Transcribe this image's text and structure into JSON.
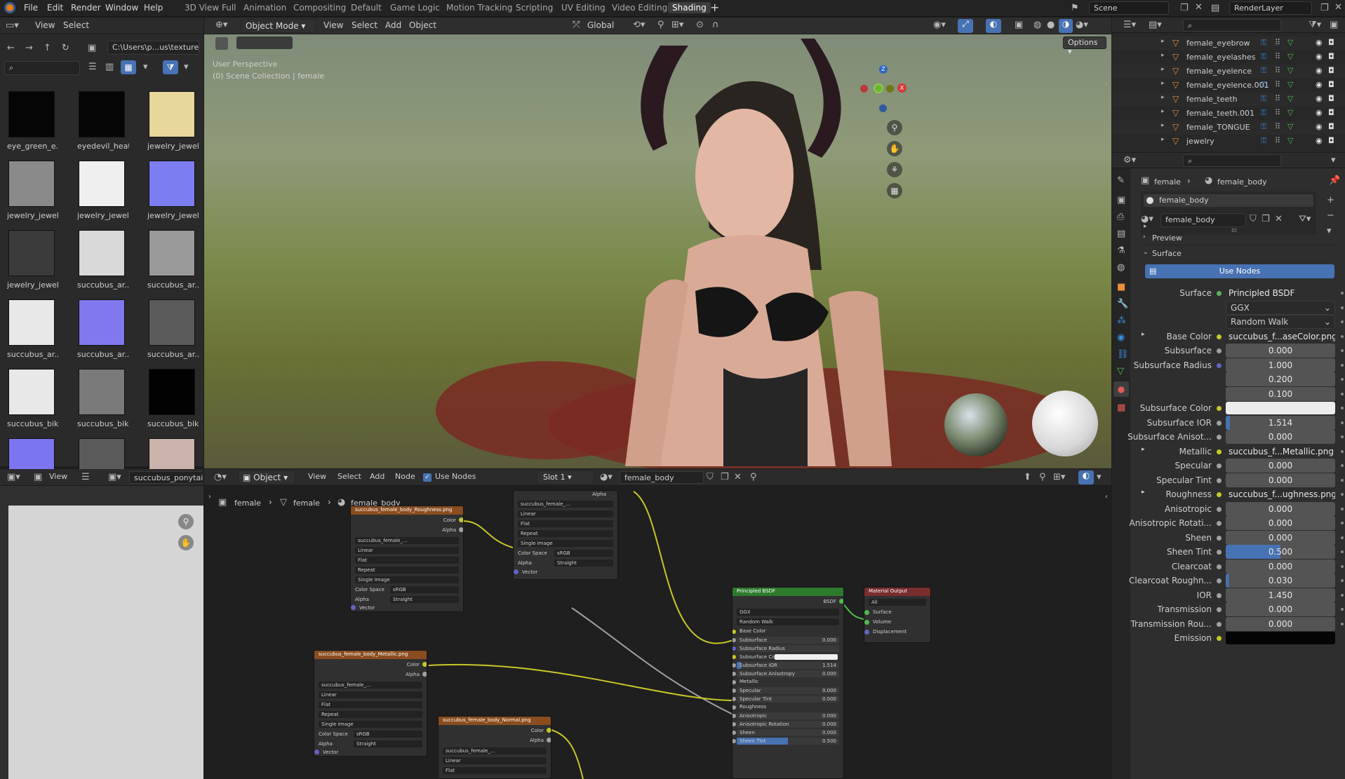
{
  "topbar": {
    "menus": [
      "File",
      "Edit",
      "Render",
      "Window",
      "Help"
    ],
    "workspaces": [
      "3D View Full",
      "Animation",
      "Compositing",
      "Default",
      "Game Logic",
      "Motion Tracking",
      "Scripting",
      "UV Editing",
      "Video Editing",
      "Shading"
    ],
    "active_workspace": "Shading",
    "scene": "Scene",
    "render_layer": "RenderLayer"
  },
  "file_browser": {
    "menus": [
      "View",
      "Select"
    ],
    "path": "C:\\Users\\p...us\\textures\\",
    "thumbnails": [
      {
        "label": "eye_green_e...",
        "color": "#050505"
      },
      {
        "label": "eyedevil_heat...",
        "color": "#050505"
      },
      {
        "label": "jewelry_jewel...",
        "color": "#e8d79a"
      },
      {
        "label": "jewelry_jewel...",
        "color": "#8a8a8a"
      },
      {
        "label": "jewelry_jewel...",
        "color": "#efefef"
      },
      {
        "label": "jewelry_jewel...",
        "color": "#7d7df2"
      },
      {
        "label": "jewelry_jewel...",
        "color": "#3b3b3b"
      },
      {
        "label": "succubus_ar...",
        "color": "#d9d9d9"
      },
      {
        "label": "succubus_ar...",
        "color": "#9a9a9a"
      },
      {
        "label": "succubus_ar...",
        "color": "#e8e8e8"
      },
      {
        "label": "succubus_ar...",
        "color": "#7f78ee"
      },
      {
        "label": "succubus_ar...",
        "color": "#5a5a5a"
      },
      {
        "label": "succubus_biki...",
        "color": "#e8e8e8"
      },
      {
        "label": "succubus_biki...",
        "color": "#7a7a7a"
      },
      {
        "label": "succubus_biki...",
        "color": "#020202"
      },
      {
        "label": "",
        "color": "#7b76f0"
      },
      {
        "label": "",
        "color": "#5a5a5a"
      },
      {
        "label": "",
        "color": "#c9b3ab"
      }
    ]
  },
  "viewport": {
    "mode": "Object Mode",
    "menus": [
      "View",
      "Select",
      "Add",
      "Object"
    ],
    "orientation": "Global",
    "options": "Options",
    "overlay_title": "User Perspective",
    "overlay_collection": "(0) Scene Collection | female",
    "axes": {
      "z": "Z",
      "x": "X",
      "y": "Y"
    }
  },
  "outliner": {
    "items": [
      "female_eyebrow",
      "female_eyelashes",
      "female_eyelence",
      "female_eyelence.001",
      "female_teeth",
      "female_teeth.001",
      "female_TONGUE",
      "jewelry"
    ]
  },
  "properties": {
    "breadcrumb": {
      "object": "female",
      "material": "female_body"
    },
    "slot_name": "female_body",
    "material_name": "female_body",
    "sections": {
      "preview": "Preview",
      "surface": "Surface"
    },
    "use_nodes": "Use Nodes",
    "rows": [
      {
        "label": "Surface",
        "value": "Principled BSDF",
        "kind": "link",
        "dot": "#5bb35b"
      },
      {
        "label": "",
        "value": "GGX",
        "kind": "dropdown"
      },
      {
        "label": "",
        "value": "Random Walk",
        "kind": "dropdown"
      },
      {
        "label": "Base Color",
        "value": "succubus_f...aseColor.png",
        "kind": "link",
        "dot": "#c8c829",
        "expand": true
      },
      {
        "label": "Subsurface",
        "value": "0.000",
        "kind": "num",
        "dot": "#a1a1a1"
      },
      {
        "label": "Subsurface Radius",
        "value": "1.000",
        "kind": "num",
        "dot": "#6363c7"
      },
      {
        "label": "",
        "value": "0.200",
        "kind": "num"
      },
      {
        "label": "",
        "value": "0.100",
        "kind": "num"
      },
      {
        "label": "Subsurface Color",
        "value": "",
        "kind": "color",
        "dot": "#c8c829"
      },
      {
        "label": "Subsurface IOR",
        "value": "1.514",
        "kind": "slider",
        "dot": "#a1a1a1",
        "fill": 0.04
      },
      {
        "label": "Subsurface Anisot...",
        "value": "0.000",
        "kind": "num",
        "dot": "#a1a1a1"
      },
      {
        "label": "Metallic",
        "value": "succubus_f...Metallic.png",
        "kind": "link",
        "dot": "#c8c829",
        "expand": true
      },
      {
        "label": "Specular",
        "value": "0.000",
        "kind": "num",
        "dot": "#a1a1a1"
      },
      {
        "label": "Specular Tint",
        "value": "0.000",
        "kind": "num",
        "dot": "#a1a1a1"
      },
      {
        "label": "Roughness",
        "value": "succubus_f...ughness.png",
        "kind": "link",
        "dot": "#c8c829",
        "expand": true
      },
      {
        "label": "Anisotropic",
        "value": "0.000",
        "kind": "num",
        "dot": "#a1a1a1"
      },
      {
        "label": "Anisotropic Rotati...",
        "value": "0.000",
        "kind": "num",
        "dot": "#a1a1a1"
      },
      {
        "label": "Sheen",
        "value": "0.000",
        "kind": "num",
        "dot": "#a1a1a1"
      },
      {
        "label": "Sheen Tint",
        "value": "0.500",
        "kind": "slider",
        "dot": "#a1a1a1",
        "fill": 0.5
      },
      {
        "label": "Clearcoat",
        "value": "0.000",
        "kind": "num",
        "dot": "#a1a1a1"
      },
      {
        "label": "Clearcoat Roughn...",
        "value": "0.030",
        "kind": "slider",
        "dot": "#a1a1a1",
        "fill": 0.03
      },
      {
        "label": "IOR",
        "value": "1.450",
        "kind": "num",
        "dot": "#a1a1a1"
      },
      {
        "label": "Transmission",
        "value": "0.000",
        "kind": "num",
        "dot": "#a1a1a1"
      },
      {
        "label": "Transmission Rou...",
        "value": "0.000",
        "kind": "num",
        "dot": "#a1a1a1"
      },
      {
        "label": "Emission",
        "value": "",
        "kind": "color-dark",
        "dot": "#c8c829"
      }
    ]
  },
  "image_editor": {
    "view": "View",
    "image_name": "succubus_ponytail_E"
  },
  "node_editor": {
    "object_label": "Object",
    "menus": [
      "View",
      "Select",
      "Add",
      "Node"
    ],
    "use_nodes": "Use Nodes",
    "slot": "Slot 1",
    "material": "female_body",
    "breadcrumb": [
      "female",
      "female",
      "female_body"
    ],
    "nodes": {
      "roughness": {
        "title": "succubus_female_body_Roughness.png",
        "image": "succubus_female_...",
        "rows": [
          "Linear",
          "Flat",
          "Repeat",
          "Single Image"
        ],
        "color_space": "sRGB",
        "alpha": "Straight"
      },
      "top": {
        "image": "succubus_female_...",
        "rows": [
          "Linear",
          "Flat",
          "Repeat",
          "Single Image"
        ],
        "color_space": "sRGB",
        "alpha": "Straight"
      },
      "metallic": {
        "title": "succubus_female_body_Metallic.png",
        "image": "succubus_female_...",
        "rows": [
          "Linear",
          "Flat",
          "Repeat",
          "Single Image"
        ],
        "color_space": "sRGB",
        "alpha": "Straight"
      },
      "normal": {
        "title": "succubus_female_body_Normal.png",
        "image": "succubus_female_...",
        "rows": [
          "Linear",
          "Flat"
        ]
      },
      "bsdf": {
        "title": "Principled BSDF",
        "output": "BSDF",
        "dist": "GGX",
        "ss_method": "Random Walk",
        "inputs": [
          {
            "label": "Base Color",
            "value": ""
          },
          {
            "label": "Subsurface",
            "value": "0.000"
          },
          {
            "label": "Subsurface Radius",
            "value": ""
          },
          {
            "label": "Subsurface Colo",
            "value": ""
          },
          {
            "label": "Subsurface IOR",
            "value": "1.514"
          },
          {
            "label": "Subsurface Anisotropy",
            "value": "0.000"
          },
          {
            "label": "Metallic",
            "value": ""
          },
          {
            "label": "Specular",
            "value": "0.000"
          },
          {
            "label": "Specular Tint",
            "value": "0.000"
          },
          {
            "label": "Roughness",
            "value": ""
          },
          {
            "label": "Anisotropic",
            "value": "0.000"
          },
          {
            "label": "Anisotropic Rotation",
            "value": "0.000"
          },
          {
            "label": "Sheen",
            "value": "0.000"
          },
          {
            "label": "Sheen Tint",
            "value": "0.500"
          }
        ]
      },
      "output": {
        "title": "Material Output",
        "target": "All",
        "inputs": [
          "Surface",
          "Volume",
          "Displacement"
        ]
      },
      "labels": {
        "color": "Color",
        "alpha": "Alpha",
        "vector": "Vector",
        "color_space": "Color Space",
        "alpha_label": "Alpha"
      }
    }
  }
}
